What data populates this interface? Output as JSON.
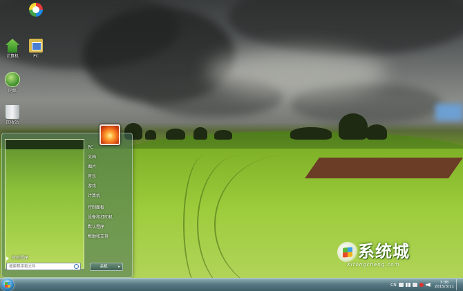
{
  "desktop": {
    "icons": [
      {
        "label": "",
        "icon": "app-shortcut-icon"
      },
      {
        "label": "计算机",
        "icon": "computer-icon"
      },
      {
        "label": "PC",
        "icon": "folder-icon"
      },
      {
        "label": "网络",
        "icon": "network-icon"
      },
      {
        "label": "回收站",
        "icon": "recycle-bin-icon"
      }
    ]
  },
  "start_menu": {
    "all_programs": "所有程序",
    "search_placeholder": "搜索程序和文件",
    "right_items": [
      "PC",
      "文档",
      "图片",
      "音乐",
      "游戏",
      "计算机",
      "控制面板",
      "设备和打印机",
      "默认程序",
      "帮助和支持"
    ],
    "shutdown_label": "关机",
    "shutdown_arrow": "▸"
  },
  "watermark": {
    "text": "系统城",
    "url": "Xitongcheng.com"
  },
  "taskbar": {
    "language": "CN",
    "time": "3:38",
    "date": "2015/3/11"
  }
}
